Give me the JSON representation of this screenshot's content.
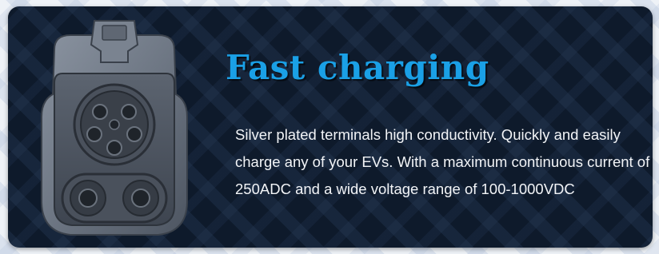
{
  "card": {
    "title": "Fast charging",
    "description": "Silver plated terminals high conductivity. Quickly and easily charge any of your EVs. With a maximum continuous current of 250ADC and a wide voltage range of 100-1000VDC"
  },
  "image": {
    "icon": "ccs2-connector-icon"
  },
  "colors": {
    "title": "#1aa0e6",
    "card_background": "#0e1a2b",
    "text": "#f2f4f7"
  }
}
